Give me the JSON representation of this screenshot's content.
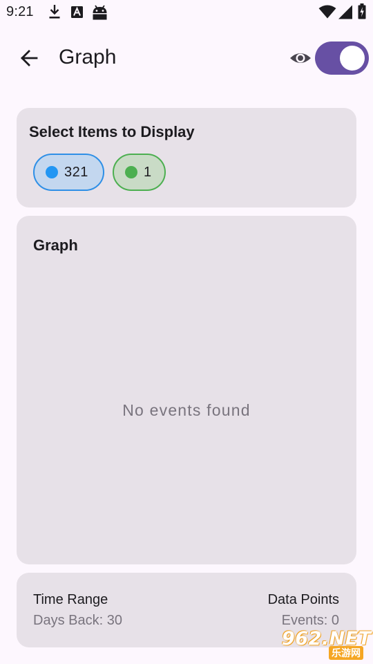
{
  "status_bar": {
    "time": "9:21",
    "icons": [
      "download-icon",
      "a-badge-icon",
      "android-icon",
      "wifi-icon",
      "signal-icon",
      "battery-icon"
    ]
  },
  "app_bar": {
    "title": "Graph",
    "back_icon": "arrow-back-icon",
    "visibility_icon": "eye-icon",
    "toggle_on": true,
    "toggle_color": "#6750a4"
  },
  "select_card": {
    "heading": "Select Items to Display",
    "chips": [
      {
        "label": "321",
        "color": "#2196f3",
        "selected": true
      },
      {
        "label": "1",
        "color": "#4caf50",
        "selected": true
      }
    ]
  },
  "graph_card": {
    "heading": "Graph",
    "empty_message": "No events found"
  },
  "footer_card": {
    "time_range_label": "Time Range",
    "time_range_value": "Days Back: 30",
    "data_points_label": "Data Points",
    "data_points_value": "Events: 0"
  },
  "watermark": {
    "main": "962.NET",
    "sub": "乐游网"
  }
}
